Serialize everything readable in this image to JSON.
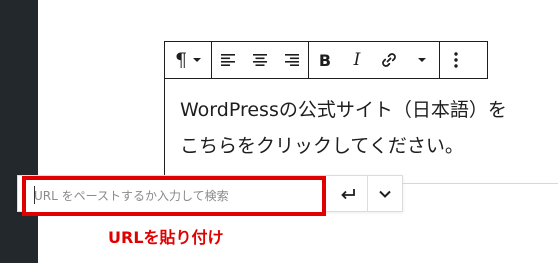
{
  "content": {
    "line1": "WordPressの公式サイト（日本語）を",
    "line2": "こちらをクリックしてください。"
  },
  "link_popover": {
    "placeholder": "URL をペーストするか入力して検索"
  },
  "annotation": {
    "text": "URLを貼り付け"
  },
  "colors": {
    "sidebar": "#23282d",
    "highlight": "#e00000",
    "toolbar_border": "#1e1e1e"
  },
  "icons": {
    "paragraph": "pilcrow-icon",
    "align_left": "align-left-icon",
    "align_center": "align-center-icon",
    "align_right": "align-right-icon",
    "bold": "bold-icon",
    "italic": "italic-icon",
    "link": "link-icon",
    "more": "more-vertical-icon",
    "submit": "enter-icon",
    "expand": "chevron-down-icon"
  }
}
